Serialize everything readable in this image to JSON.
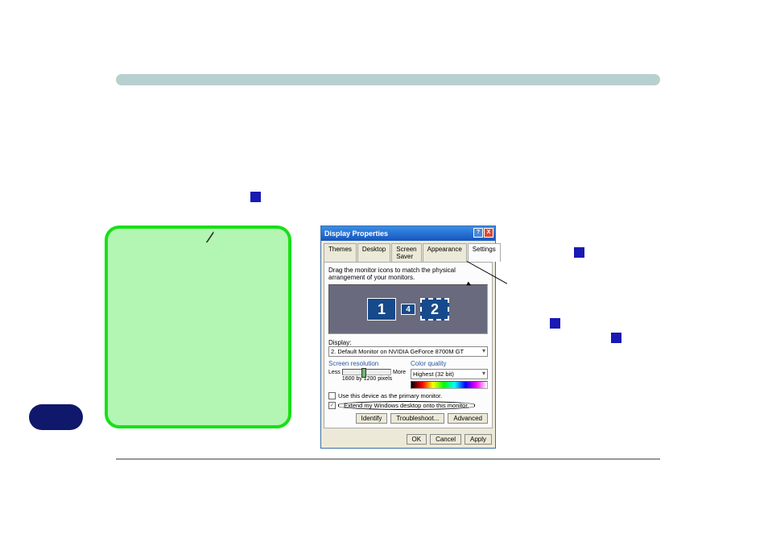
{
  "dialog": {
    "title": "Display Properties",
    "tb_help": "?",
    "tb_close": "X",
    "tabs": {
      "themes": "Themes",
      "desktop": "Desktop",
      "screensaver": "Screen Saver",
      "appearance": "Appearance",
      "settings": "Settings"
    },
    "instruction": "Drag the monitor icons to match the physical arrangement of your monitors.",
    "monitor1": "1",
    "monitor2": "2",
    "monitor4": "4",
    "display_label": "Display:",
    "display_value": "2. Default Monitor on NVIDIA GeForce 8700M GT",
    "res_title": "Screen resolution",
    "res_less": "Less",
    "res_more": "More",
    "res_caption": "1600 by 1200 pixels",
    "cq_title": "Color quality",
    "cq_value": "Highest (32 bit)",
    "ch_primary": "Use this device as the primary monitor.",
    "ch_extend": "Extend my Windows desktop onto this monitor.",
    "btn_identify": "Identify",
    "btn_ts": "Troubleshoot...",
    "btn_adv": "Advanced",
    "btn_ok": "OK",
    "btn_cancel": "Cancel",
    "btn_apply": "Apply"
  }
}
